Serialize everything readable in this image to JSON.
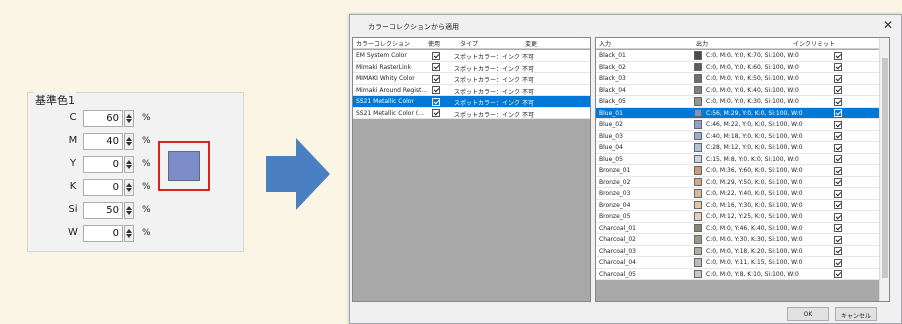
{
  "left_panel": {
    "legend": "基準色1",
    "unit": "%",
    "rows": [
      {
        "label": "C",
        "value": "60"
      },
      {
        "label": "M",
        "value": "40"
      },
      {
        "label": "Y",
        "value": "0"
      },
      {
        "label": "K",
        "value": "0"
      },
      {
        "label": "Si",
        "value": "50"
      },
      {
        "label": "W",
        "value": "0"
      }
    ],
    "swatch_color": "#7b8cc8",
    "highlight_color": "#e02020"
  },
  "arrow_color": "#4a7fc1",
  "dialog": {
    "title": "カラーコレクションから適用",
    "close_glyph": "✕",
    "collections": {
      "headers": [
        "カラーコレクション",
        "使用",
        "タイプ",
        "変更"
      ],
      "rows": [
        {
          "name": "EM System Color",
          "type": "スポットカラー：インク",
          "change": "不可",
          "selected": false
        },
        {
          "name": "Mimaki RasterLink",
          "type": "スポットカラー：インク",
          "change": "不可",
          "selected": false
        },
        {
          "name": "MIMAKI Whity Color",
          "type": "スポットカラー：インク",
          "change": "不可",
          "selected": false
        },
        {
          "name": "Mimaki Around Regist...",
          "type": "スポットカラー：インク",
          "change": "不可",
          "selected": false
        },
        {
          "name": "SS21 Metallic Color",
          "type": "スポットカラー：インク",
          "change": "不可",
          "selected": true
        },
        {
          "name": "SS21 Metallic Color (...",
          "type": "スポットカラー：インク",
          "change": "不可",
          "selected": false
        }
      ]
    },
    "colors": {
      "headers": [
        "入力",
        "出力",
        "インクリミット"
      ],
      "rows": [
        {
          "input": "Black_01",
          "output": "C:0, M:0, Y:0, K:70, Si:100, W:0",
          "swatch": "#4a4a4a",
          "selected": false
        },
        {
          "input": "Black_02",
          "output": "C:0, M:0, Y:0, K:60, Si:100, W:0",
          "swatch": "#5c5c5c",
          "selected": false
        },
        {
          "input": "Black_03",
          "output": "C:0, M:0, Y:0, K:50, Si:100, W:0",
          "swatch": "#6e6e6e",
          "selected": false
        },
        {
          "input": "Black_04",
          "output": "C:0, M:0, Y:0, K:40, Si:100, W:0",
          "swatch": "#808080",
          "selected": false
        },
        {
          "input": "Black_05",
          "output": "C:0, M:0, Y:0, K:30, Si:100, W:0",
          "swatch": "#959595",
          "selected": false
        },
        {
          "input": "Blue_01",
          "output": "C:56, M:29, Y:0, K:0, Si:100, W:0",
          "swatch": "#7d95c4",
          "selected": true
        },
        {
          "input": "Blue_02",
          "output": "C:46, M:22, Y:0, K:0, Si:100, W:0",
          "swatch": "#8ea3cc",
          "selected": false
        },
        {
          "input": "Blue_03",
          "output": "C:40, M:18, Y:0, K:0, Si:100, W:0",
          "swatch": "#9aaed3",
          "selected": false
        },
        {
          "input": "Blue_04",
          "output": "C:28, M:12, Y:0, K:0, Si:100, W:0",
          "swatch": "#b1c0dc",
          "selected": false
        },
        {
          "input": "Blue_05",
          "output": "C:15, M:8, Y:0, K:0, Si:100, W:0",
          "swatch": "#c9d3e6",
          "selected": false
        },
        {
          "input": "Bronze_01",
          "output": "C:0, M:36, Y:60, K:0, Si:100, W:0",
          "swatch": "#c99a73",
          "selected": false
        },
        {
          "input": "Bronze_02",
          "output": "C:0, M:29, Y:50, K:0, Si:100, W:0",
          "swatch": "#d1a985",
          "selected": false
        },
        {
          "input": "Bronze_03",
          "output": "C:0, M:22, Y:40, K:0, Si:100, W:0",
          "swatch": "#d8b898",
          "selected": false
        },
        {
          "input": "Bronze_04",
          "output": "C:0, M:16, Y:30, K:0, Si:100, W:0",
          "swatch": "#dfc6ab",
          "selected": false
        },
        {
          "input": "Bronze_05",
          "output": "C:0, M:12, Y:25, K:0, Si:100, W:0",
          "swatch": "#e3cfb8",
          "selected": false
        },
        {
          "input": "Charcoal_01",
          "output": "C:0, M:0, Y:46, K:40, Si:100, W:0",
          "swatch": "#8a8670",
          "selected": false
        },
        {
          "input": "Charcoal_02",
          "output": "C:0, M:0, Y:30, K:30, Si:100, W:0",
          "swatch": "#9c9a88",
          "selected": false
        },
        {
          "input": "Charcoal_03",
          "output": "C:0, M:0, Y:18, K:20, Si:100, W:0",
          "swatch": "#b0ae a2",
          "selected": false
        },
        {
          "input": "Charcoal_04",
          "output": "C:0, M:0, Y:11, K:15, Si:100, W:0",
          "swatch": "#bdbcb3",
          "selected": false
        },
        {
          "input": "Charcoal_05",
          "output": "C:0, M:0, Y:8, K:10, Si:100, W:0",
          "swatch": "#cac9c2",
          "selected": false
        }
      ]
    },
    "ok_label": "OK",
    "cancel_label": "キャンセル"
  }
}
